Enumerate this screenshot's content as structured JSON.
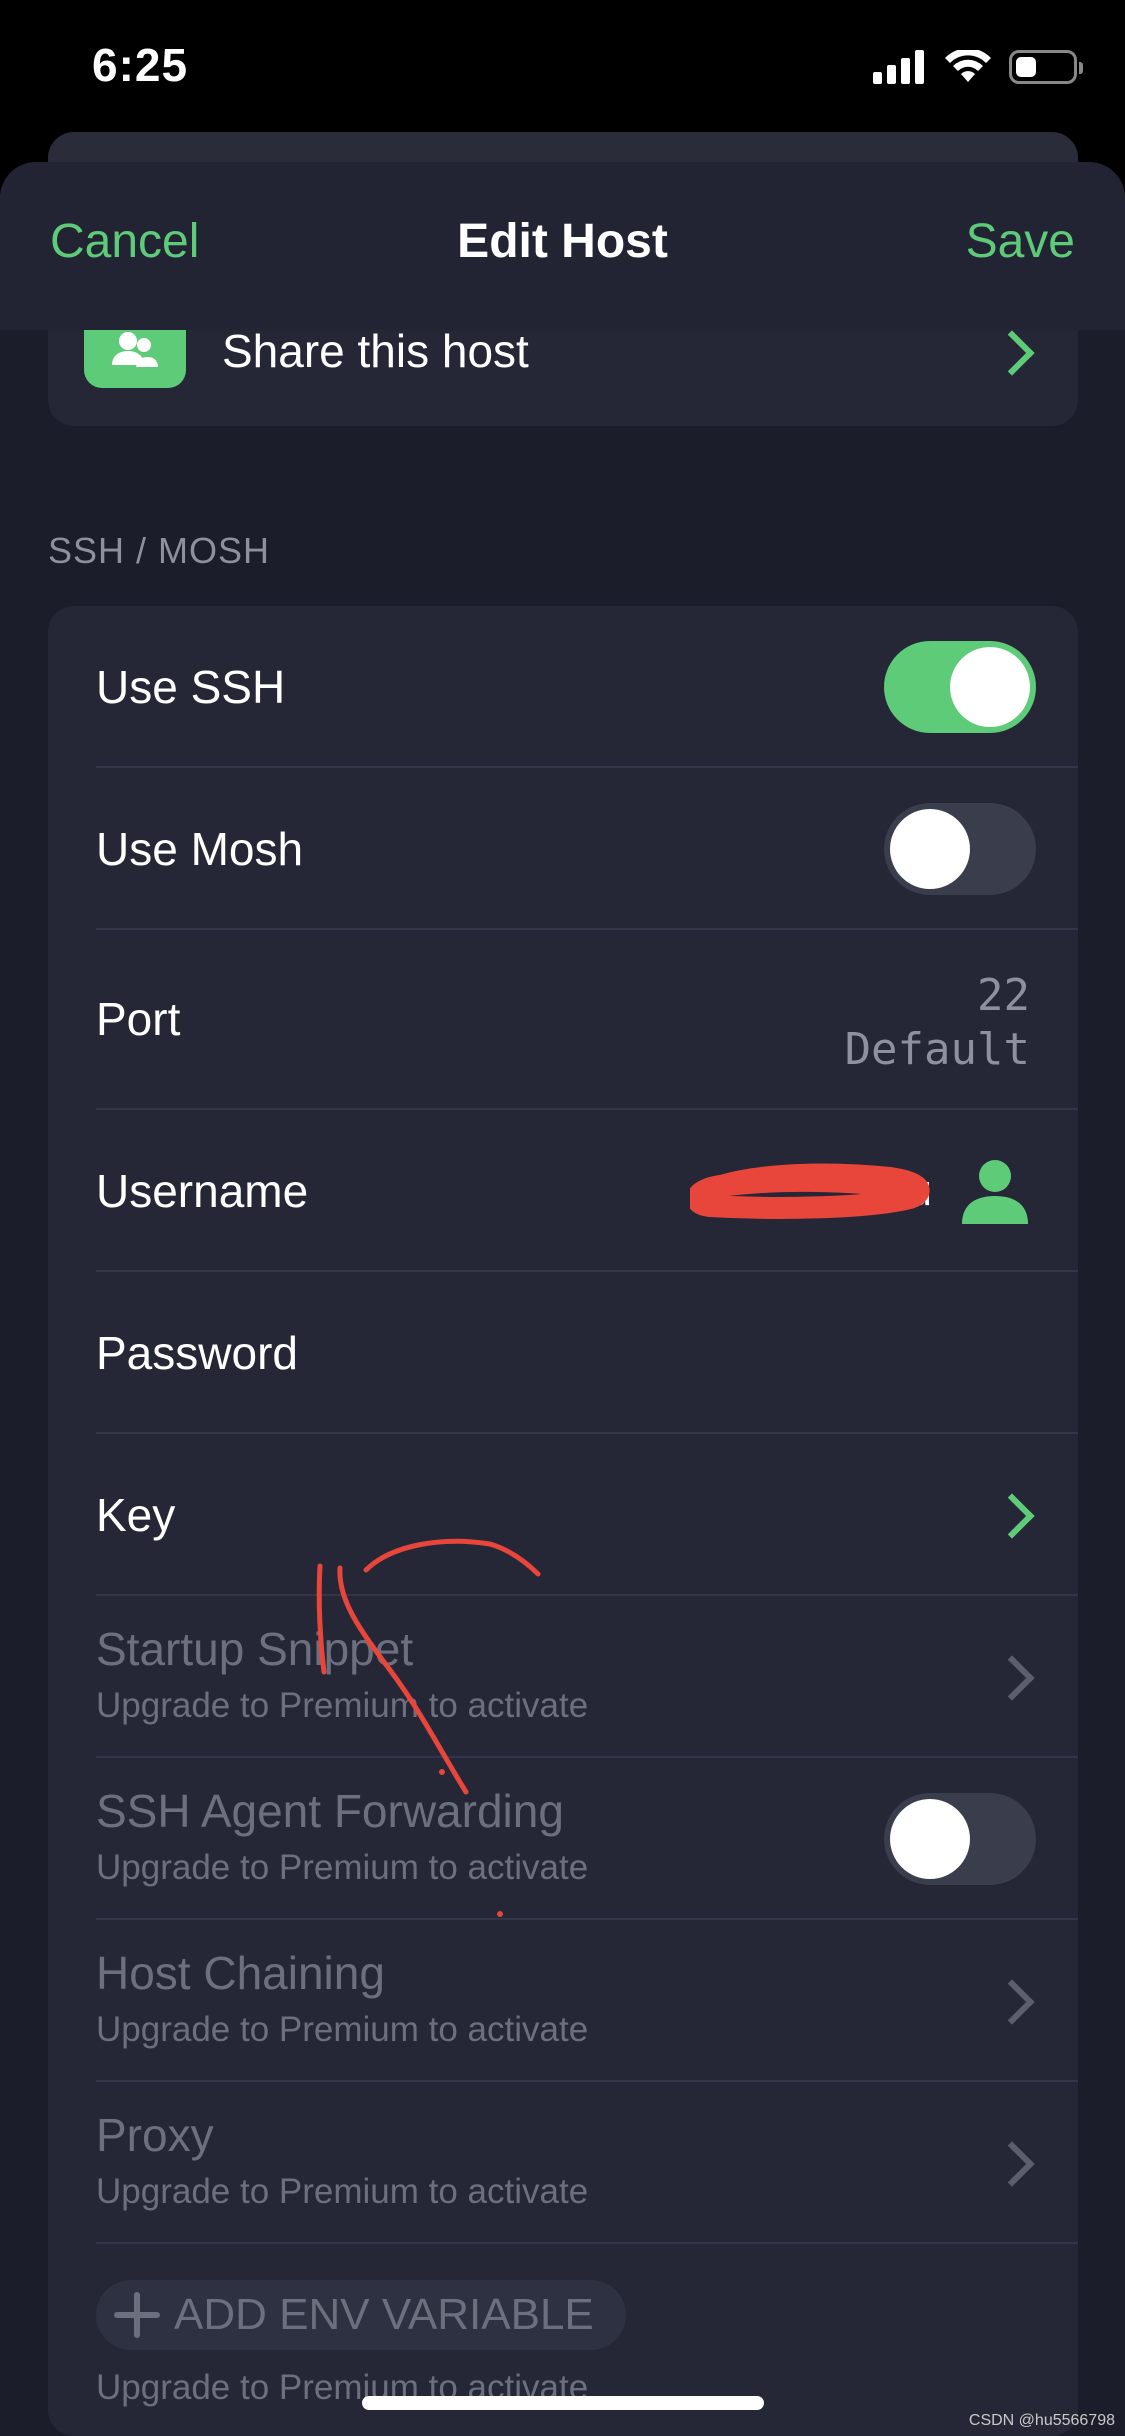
{
  "status_bar": {
    "time": "6:25",
    "battery_level": 0.35
  },
  "nav": {
    "cancel": "Cancel",
    "title": "Edit Host",
    "save": "Save"
  },
  "share": {
    "label": "Share this host",
    "icon": "people-icon"
  },
  "section": {
    "title": "SSH / MOSH"
  },
  "rows": {
    "use_ssh": {
      "label": "Use SSH",
      "enabled": true
    },
    "use_mosh": {
      "label": "Use Mosh",
      "enabled": false
    },
    "port": {
      "label": "Port",
      "value": "22",
      "hint": "Default"
    },
    "username": {
      "label": "Username",
      "value_suffix": "u"
    },
    "password": {
      "label": "Password"
    },
    "key": {
      "label": "Key"
    },
    "startup_snippet": {
      "label": "Startup Snippet",
      "sub": "Upgrade to Premium to activate"
    },
    "agent_forwarding": {
      "label": "SSH Agent Forwarding",
      "sub": "Upgrade to Premium to activate",
      "enabled": false
    },
    "host_chaining": {
      "label": "Host Chaining",
      "sub": "Upgrade to Premium to activate"
    },
    "proxy": {
      "label": "Proxy",
      "sub": "Upgrade to Premium to activate"
    },
    "env": {
      "button": "ADD ENV VARIABLE",
      "sub": "Upgrade to Premium to activate"
    }
  },
  "colors": {
    "accent": "#5ecb78",
    "background": "#1b1d2a",
    "card": "#252736",
    "annotation": "#e8463a"
  },
  "watermark": "CSDN @hu5566798"
}
